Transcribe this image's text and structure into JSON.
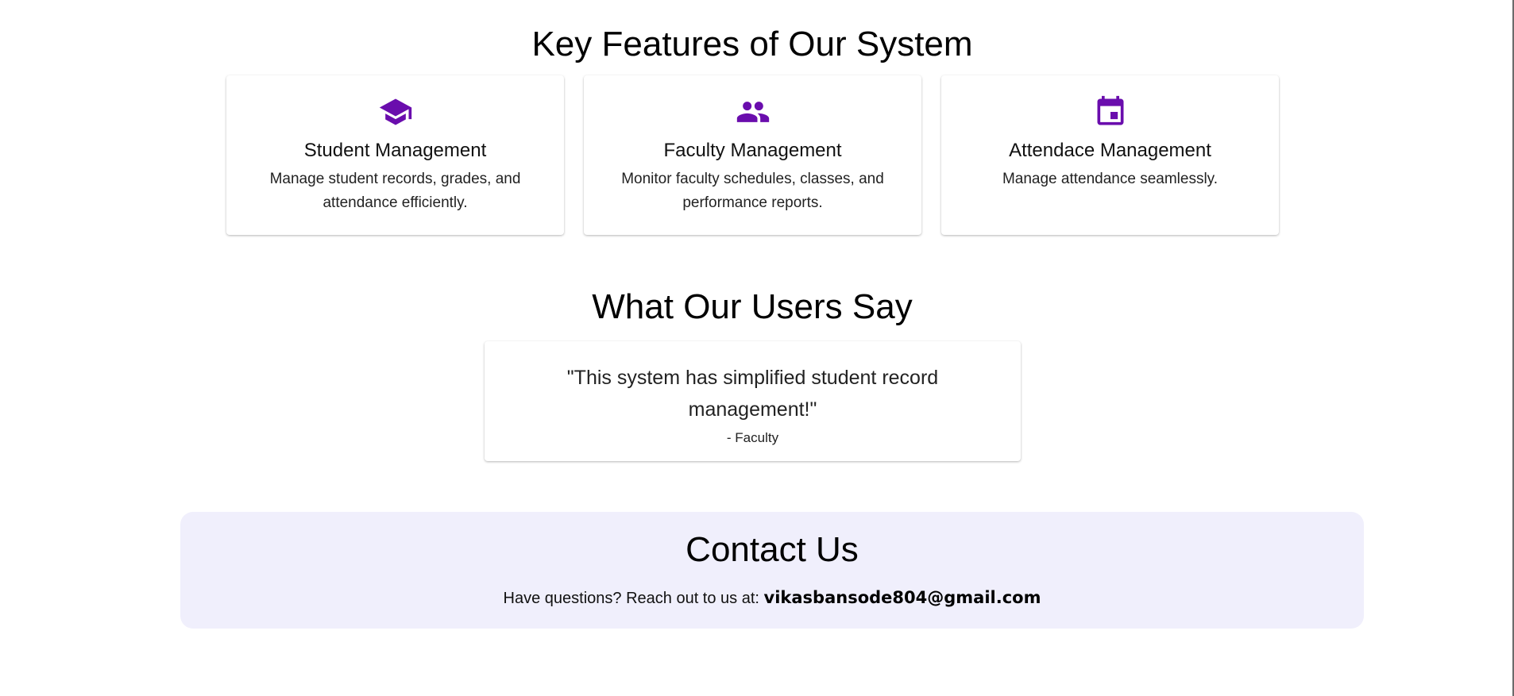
{
  "colors": {
    "accent": "#6a0dad",
    "contact_background": "#f0effc"
  },
  "features": {
    "title": "Key Features of Our System",
    "cards": [
      {
        "icon": "graduation-cap-icon",
        "heading": "Student Management",
        "description": "Manage student records, grades, and attendance efficiently."
      },
      {
        "icon": "people-icon",
        "heading": "Faculty Management",
        "description": "Monitor faculty schedules, classes, and performance reports."
      },
      {
        "icon": "calendar-icon",
        "heading": "Attendace Management",
        "description": "Manage attendance seamlessly."
      }
    ]
  },
  "testimonials": {
    "title": "What Our Users Say",
    "items": [
      {
        "quote": "\"This system has simplified student record management!\"",
        "author": "- Faculty"
      }
    ]
  },
  "contact": {
    "title": "Contact Us",
    "prompt": "Have questions? Reach out to us at: ",
    "email": "vikasbansode804@gmail.com"
  }
}
